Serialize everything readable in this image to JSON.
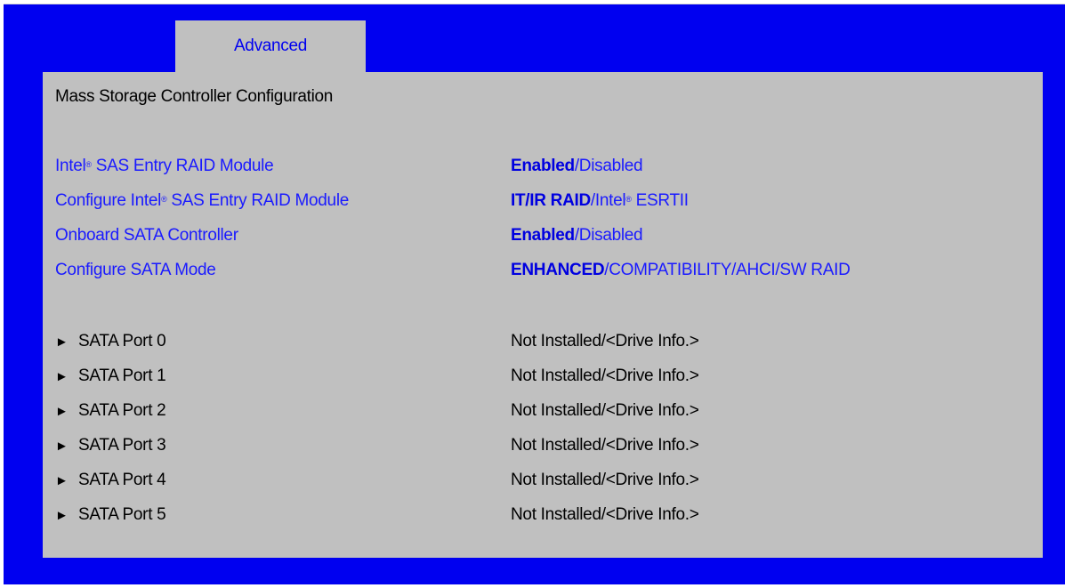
{
  "tab": {
    "label": "Advanced"
  },
  "page": {
    "title": "Mass Storage Controller Configuration"
  },
  "settings": [
    {
      "label_pre": "Intel",
      "label_sup": "®",
      "label_post": " SAS Entry RAID Module",
      "value_bold": "Enabled",
      "value_rest": "/Disabled",
      "value_sup": "",
      "value_tail": ""
    },
    {
      "label_pre": "Configure Intel",
      "label_sup": "®",
      "label_post": " SAS Entry RAID Module",
      "value_bold": "IT/IR RAID",
      "value_rest": "/Intel",
      "value_sup": "®",
      "value_tail": " ESRTII"
    },
    {
      "label_pre": "Onboard SATA Controller",
      "label_sup": "",
      "label_post": "",
      "value_bold": "Enabled",
      "value_rest": "/Disabled",
      "value_sup": "",
      "value_tail": ""
    },
    {
      "label_pre": "Configure SATA Mode",
      "label_sup": "",
      "label_post": "",
      "value_bold": "ENHANCED",
      "value_rest": "/COMPATIBILITY/AHCI/SW RAID",
      "value_sup": "",
      "value_tail": ""
    }
  ],
  "ports": [
    {
      "arrow": "►",
      "label": "SATA Port 0",
      "value": "Not Installed/<Drive Info.>"
    },
    {
      "arrow": "►",
      "label": "SATA Port 1",
      "value": "Not Installed/<Drive Info.>"
    },
    {
      "arrow": "►",
      "label": "SATA Port 2",
      "value": "Not Installed/<Drive Info.>"
    },
    {
      "arrow": "►",
      "label": "SATA Port 3",
      "value": "Not Installed/<Drive Info.>"
    },
    {
      "arrow": "►",
      "label": "SATA Port 4",
      "value": "Not Installed/<Drive Info.>"
    },
    {
      "arrow": "►",
      "label": "SATA Port 5",
      "value": "Not Installed/<Drive Info.>"
    }
  ],
  "colors": {
    "background": "#0000f0",
    "panel": "#c0c0c0",
    "setting_text": "#1a1aff",
    "static_text": "#000000"
  }
}
